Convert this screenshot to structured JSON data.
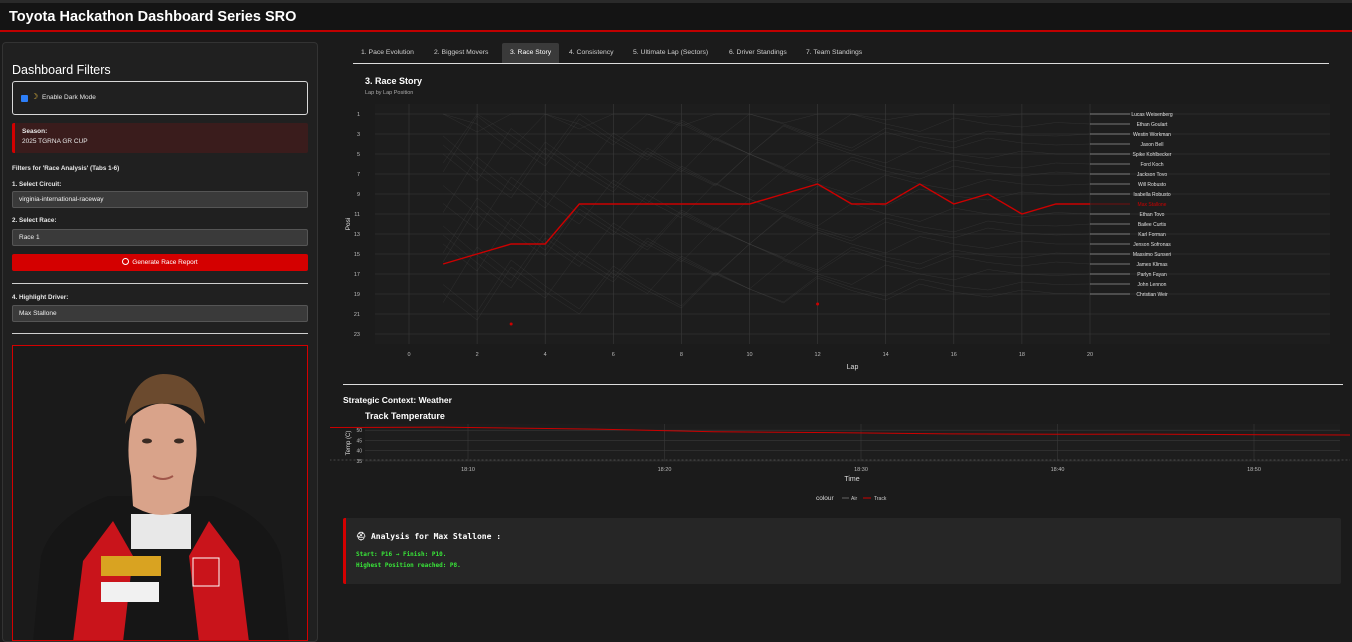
{
  "app": {
    "title": "Toyota Hackathon Dashboard Series SRO"
  },
  "sidebar": {
    "title": "Dashboard Filters",
    "dark_mode_label": "Enable Dark Mode",
    "season_label": "Season:",
    "season_value": "2025 TGRNA GR CUP",
    "filters_heading": "Filters for 'Race Analysis' (Tabs 1-6)",
    "circuit_label": "1. Select Circuit:",
    "circuit_value": "virginia-international-raceway",
    "race_label": "2. Select Race:",
    "race_value": "Race 1",
    "generate_label": "Generate Race Report",
    "highlight_label": "4. Highlight Driver:",
    "highlight_value": "Max Stallone"
  },
  "tabs": [
    "1. Pace Evolution",
    "2. Biggest Movers",
    "3. Race Story",
    "4. Consistency",
    "5. Ultimate Lap (Sectors)",
    "6. Driver Standings",
    "7. Team Standings"
  ],
  "active_tab": 2,
  "race_story": {
    "title": "3. Race Story",
    "subtitle": "Lap by Lap Position"
  },
  "weather": {
    "section_title": "Strategic Context: Weather",
    "title": "Track Temperature"
  },
  "analysis": {
    "heading": "Analysis for Max Stallone :",
    "line1": "Start: P16 → Finish: P10.",
    "line2": "Highest Position reached: P8."
  },
  "colors": {
    "accent": "#d40000",
    "highlight": "#cc0000",
    "background": "#1b1b1b",
    "panel": "#202020"
  },
  "chart_data": [
    {
      "type": "line",
      "xlabel": "Lap",
      "ylabel": "Posi",
      "xlim": [
        0,
        20
      ],
      "ylim": [
        24,
        0
      ],
      "x_ticks": [
        0,
        2,
        4,
        6,
        8,
        10,
        12,
        14,
        16,
        18,
        20
      ],
      "y_ticks": [
        1,
        3,
        5,
        7,
        9,
        11,
        13,
        15,
        17,
        19,
        21,
        23
      ],
      "highlight_series": {
        "name": "Max Stallone",
        "x": [
          1,
          2,
          3,
          4,
          5,
          6,
          7,
          8,
          9,
          10,
          11,
          12,
          13,
          14,
          15,
          16,
          17,
          18,
          19,
          20
        ],
        "y": [
          16,
          15,
          14,
          14,
          10,
          10,
          10,
          10,
          10,
          10,
          9,
          8,
          10,
          10,
          8,
          10,
          9,
          11,
          10,
          10
        ]
      },
      "end_labels": [
        "Lucas Weisenberg",
        "Ethan Goulart",
        "Westin Workman",
        "Jaxon Bell",
        "Spike Kohlbecker",
        "Ford Koch",
        "Jackson Tovo",
        "Will Robusto",
        "Isabella Robusto",
        "Max Stallone",
        "Ethan Tovo",
        "Bailee Curtis",
        "Karl Forman",
        "Jenson Sofronas",
        "Massimo Sunseri",
        "James Klimas",
        "Parlyn Fayan",
        "John Lennon",
        "Christian Weir"
      ],
      "end_positions": [
        1,
        2,
        3,
        4,
        5,
        6,
        7,
        8,
        9,
        10,
        11,
        12,
        13,
        14,
        15,
        16,
        17,
        18,
        19
      ],
      "highlight_index": 9,
      "markers": [
        {
          "x": 3,
          "y": 22
        },
        {
          "x": 12,
          "y": 20
        }
      ]
    },
    {
      "type": "line",
      "title": "Track Temperature",
      "xlabel": "Time",
      "ylabel": "Temp (C)",
      "x_ticks": [
        "18:10",
        "18:20",
        "18:30",
        "18:40",
        "18:50"
      ],
      "y_ticks": [
        35,
        40,
        45,
        50
      ],
      "ylim": [
        35,
        53
      ],
      "legend_title": "colour",
      "legend": [
        "Air",
        "Track"
      ],
      "series": [
        {
          "name": "Track",
          "x_minutes": [
            0,
            8,
            16,
            22,
            28,
            34,
            40,
            44,
            50,
            56,
            60
          ],
          "values": [
            51.2,
            51.5,
            50.5,
            49.2,
            48.8,
            48.2,
            48.0,
            48.1,
            47.8,
            47.6,
            47.4
          ]
        },
        {
          "name": "Air",
          "x_minutes": [
            0,
            60
          ],
          "values": [
            35.5,
            35.5
          ]
        }
      ]
    }
  ]
}
